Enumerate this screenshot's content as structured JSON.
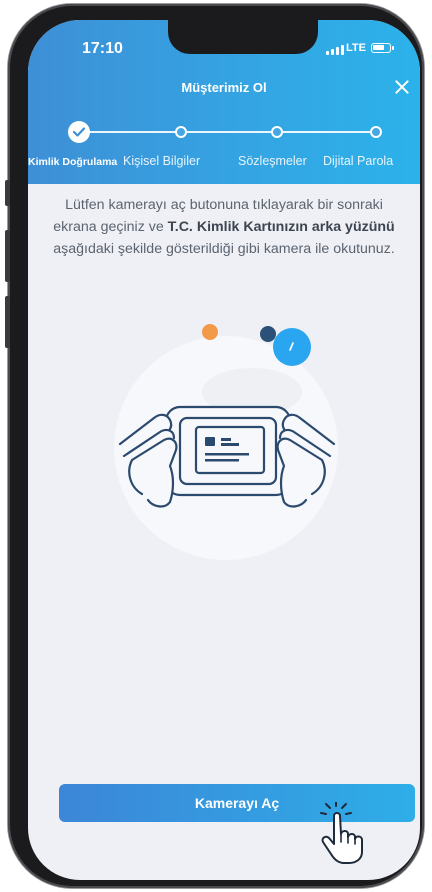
{
  "status_bar": {
    "time": "17:10",
    "network": "LTE"
  },
  "header": {
    "title": "Müşterimiz Ol",
    "close_icon": "close-icon"
  },
  "stepper": {
    "steps": [
      {
        "label": "Kimlik Doğrulama",
        "state": "completed"
      },
      {
        "label": "Kişisel Bilgiler",
        "state": "pending"
      },
      {
        "label": "Sözleşmeler",
        "state": "pending"
      },
      {
        "label": "Dijital Parola",
        "state": "pending"
      }
    ]
  },
  "instructions": {
    "part1": "Lütfen kamerayı aç butonuna tıklayarak bir sonraki ekrana geçiniz ve ",
    "bold1": "T.C. Kimlik Kartınızın arka yüzünü",
    "part2": " aşağıdaki şekilde gösterildiği gibi kamera ile okutunuz."
  },
  "illustration": {
    "name": "hands-holding-phone-scanning-id-card",
    "accent_orange": "#f29a4a",
    "accent_navy": "#2c5178",
    "accent_blue": "#2aa6f0"
  },
  "camera_button": {
    "label": "Kamerayı Aç"
  },
  "colors": {
    "header_start": "#3e8fd6",
    "header_end": "#2cb2ea",
    "background": "#eef0f5",
    "text": "#5c6470"
  }
}
